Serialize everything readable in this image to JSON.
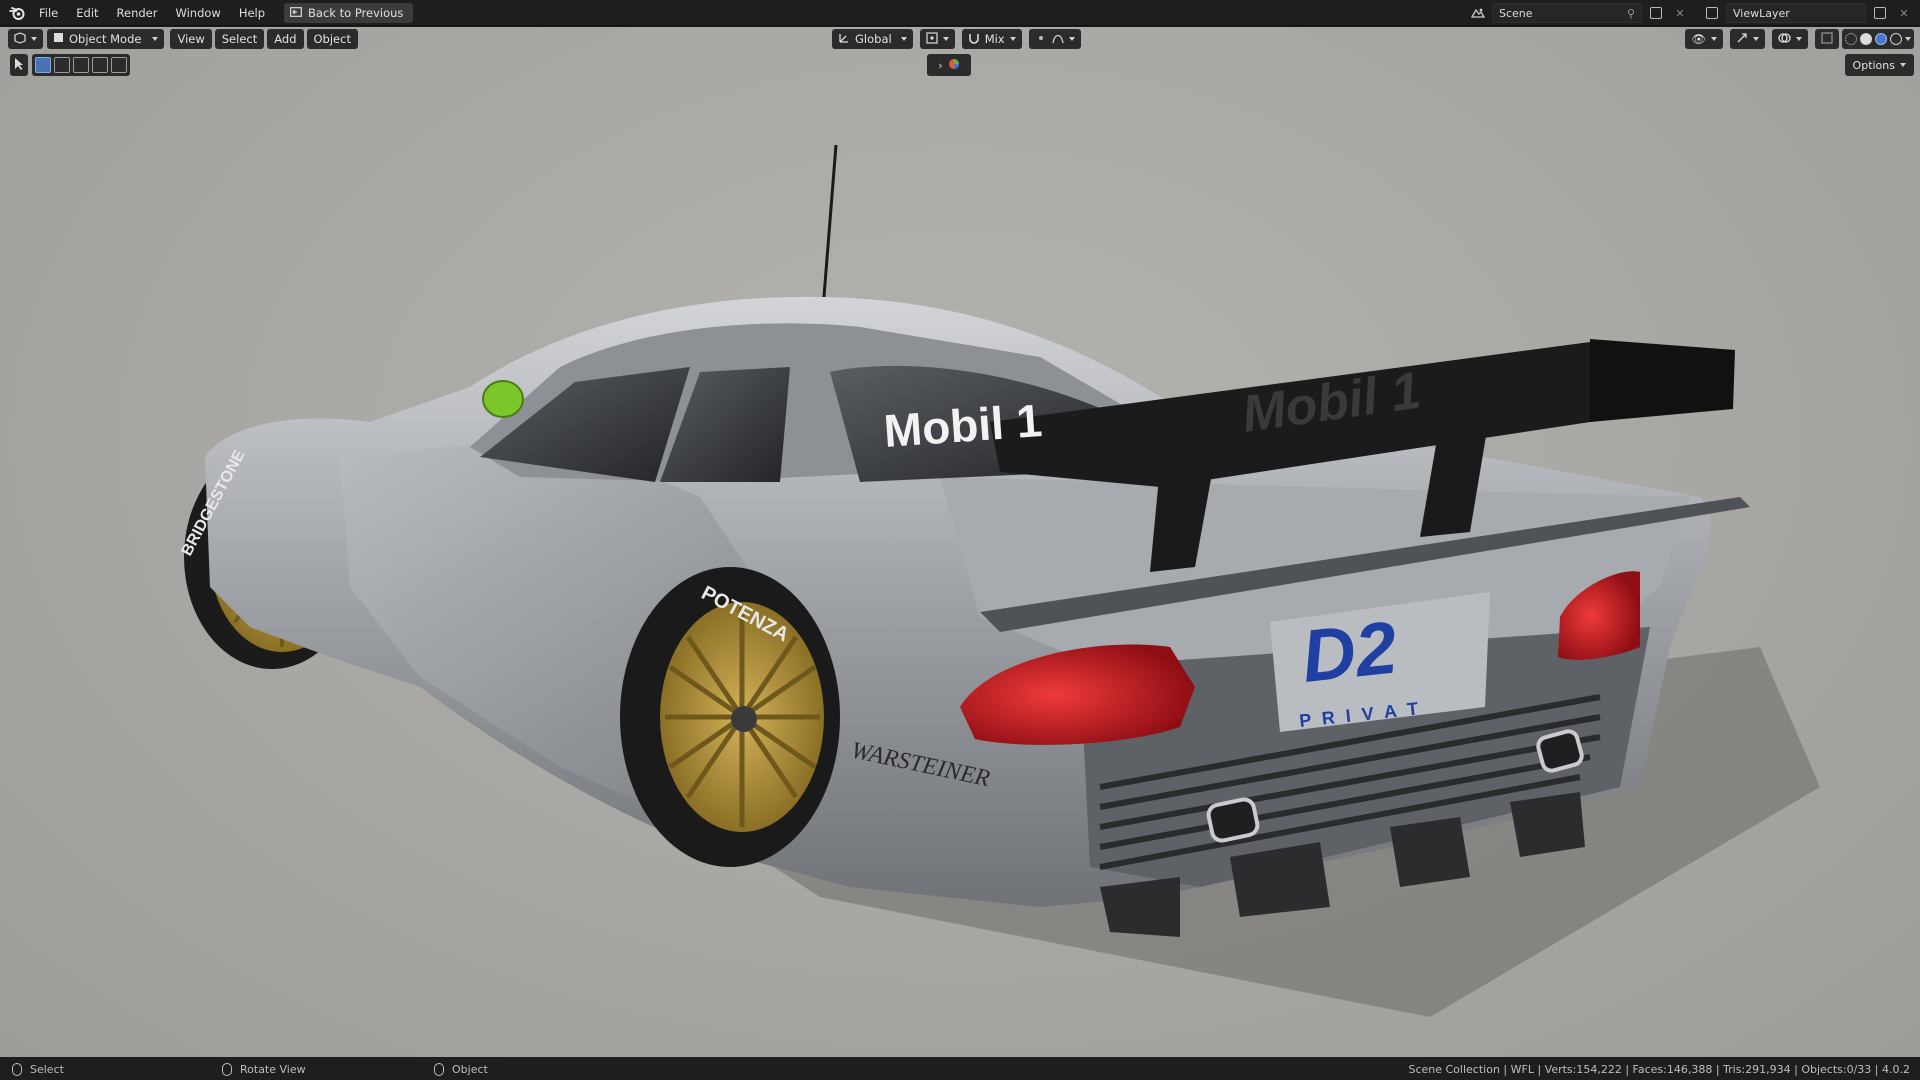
{
  "topbar": {
    "menus": [
      "File",
      "Edit",
      "Render",
      "Window",
      "Help"
    ],
    "back_label": "Back to Previous",
    "scene_name": "Scene",
    "view_layer": "ViewLayer"
  },
  "viewport_header": {
    "mode_label": "Object Mode",
    "menus": [
      "View",
      "Select",
      "Add",
      "Object"
    ],
    "transform_orientation": "Global",
    "snap_mode": "Mix",
    "options_label": "Options"
  },
  "scene": {
    "livery_sponsor_windshield": "Mobil 1",
    "livery_wing": "Mobil 1",
    "livery_plate_top": "D2",
    "livery_plate_bottom": "P R I V A T",
    "livery_bumper": "WARSTEINER",
    "tire_brand_1": "BRIDGESTONE",
    "tire_brand_2": "POTENZA",
    "wheel_color": "#a88c3a",
    "body_color": "#9c9fa4",
    "wing_color": "#1a1a1a",
    "taillight_color": "#b3161e"
  },
  "statusbar": {
    "left_action": "Select",
    "middle_action": "Rotate View",
    "right_action": "Object",
    "stats": "Scene Collection | WFL | Verts:154,222 | Faces:146,388 | Tris:291,934 | Objects:0/33 | 4.0.2"
  }
}
